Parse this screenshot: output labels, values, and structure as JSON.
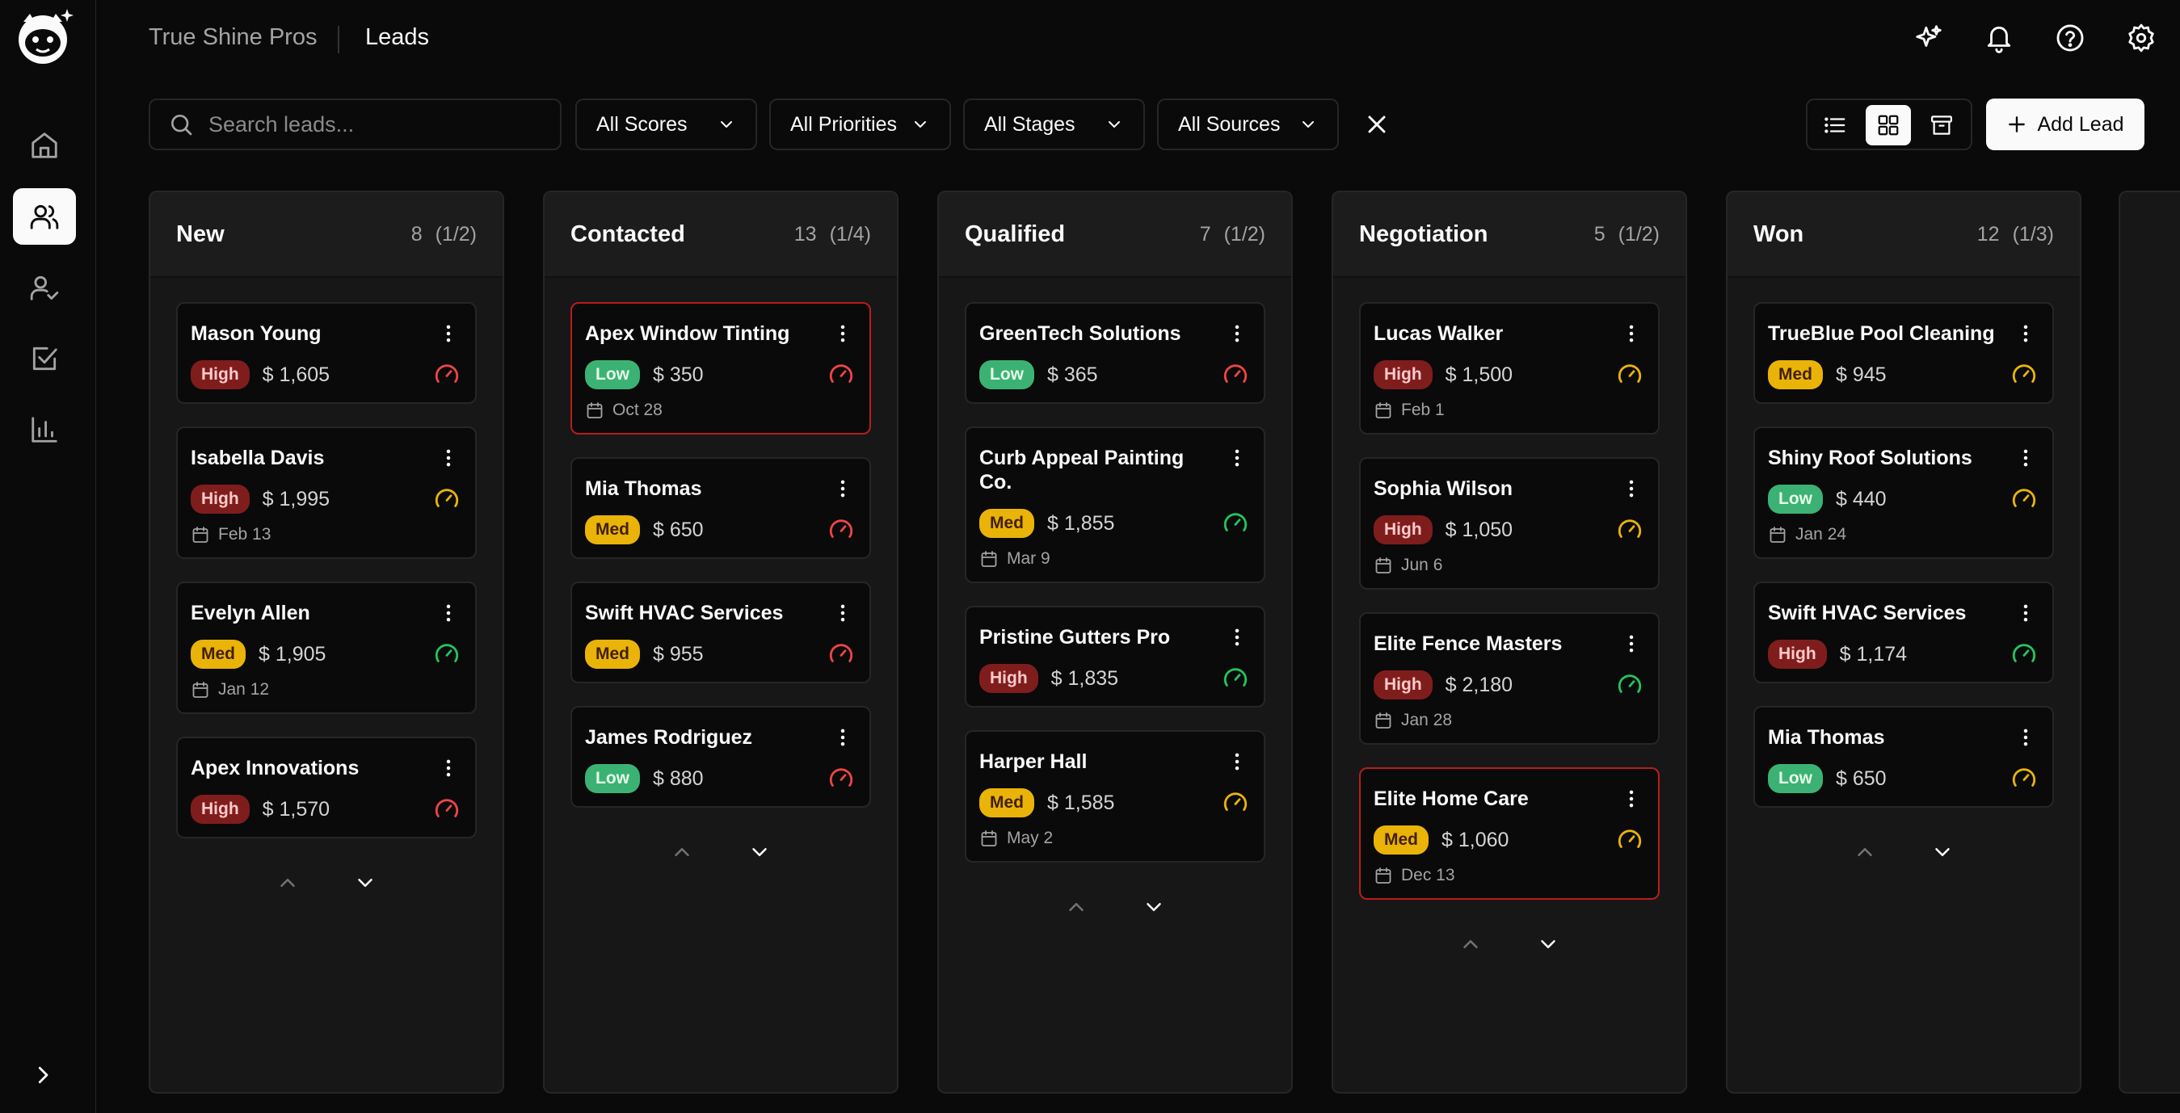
{
  "header": {
    "org": "True Shine Pros",
    "page": "Leads"
  },
  "toolbar": {
    "search_placeholder": "Search leads...",
    "filters": [
      "All Scores",
      "All Priorities",
      "All Stages",
      "All Sources"
    ],
    "add_lead_label": "Add Lead",
    "active_view": "board"
  },
  "sidebar": {
    "items": [
      "home-icon",
      "users-icon",
      "user-check-icon",
      "tasks-icon",
      "reports-icon"
    ],
    "active_index": 1
  },
  "colors": {
    "high": "#7f1d1d",
    "med": "#eab308",
    "low": "#3bb273",
    "alert_border": "#b91c1c",
    "gauge_red": "#ef4444",
    "gauge_yellow": "#eab308",
    "gauge_green": "#22c55e"
  },
  "columns": [
    {
      "title": "New",
      "count": "8",
      "page": "(1/2)",
      "cards": [
        {
          "name": "Mason Young",
          "priority": "High",
          "amount": "$ 1,605",
          "date": "",
          "gauge": "red",
          "alert": false
        },
        {
          "name": "Isabella Davis",
          "priority": "High",
          "amount": "$ 1,995",
          "date": "Feb 13",
          "gauge": "yellow",
          "alert": false
        },
        {
          "name": "Evelyn Allen",
          "priority": "Med",
          "amount": "$ 1,905",
          "date": "Jan 12",
          "gauge": "green",
          "alert": false
        },
        {
          "name": "Apex Innovations",
          "priority": "High",
          "amount": "$ 1,570",
          "date": "",
          "gauge": "red",
          "alert": false
        }
      ]
    },
    {
      "title": "Contacted",
      "count": "13",
      "page": "(1/4)",
      "cards": [
        {
          "name": "Apex Window Tinting",
          "priority": "Low",
          "amount": "$ 350",
          "date": "Oct 28",
          "gauge": "red",
          "alert": true
        },
        {
          "name": "Mia Thomas",
          "priority": "Med",
          "amount": "$ 650",
          "date": "",
          "gauge": "red",
          "alert": false
        },
        {
          "name": "Swift HVAC Services",
          "priority": "Med",
          "amount": "$ 955",
          "date": "",
          "gauge": "red",
          "alert": false
        },
        {
          "name": "James Rodriguez",
          "priority": "Low",
          "amount": "$ 880",
          "date": "",
          "gauge": "red",
          "alert": false
        }
      ]
    },
    {
      "title": "Qualified",
      "count": "7",
      "page": "(1/2)",
      "cards": [
        {
          "name": "GreenTech Solutions",
          "priority": "Low",
          "amount": "$ 365",
          "date": "",
          "gauge": "red",
          "alert": false
        },
        {
          "name": "Curb Appeal Painting Co.",
          "priority": "Med",
          "amount": "$ 1,855",
          "date": "Mar 9",
          "gauge": "green",
          "alert": false
        },
        {
          "name": "Pristine Gutters Pro",
          "priority": "High",
          "amount": "$ 1,835",
          "date": "",
          "gauge": "green",
          "alert": false
        },
        {
          "name": "Harper Hall",
          "priority": "Med",
          "amount": "$ 1,585",
          "date": "May 2",
          "gauge": "yellow",
          "alert": false
        }
      ]
    },
    {
      "title": "Negotiation",
      "count": "5",
      "page": "(1/2)",
      "cards": [
        {
          "name": "Lucas Walker",
          "priority": "High",
          "amount": "$ 1,500",
          "date": "Feb 1",
          "gauge": "yellow",
          "alert": false
        },
        {
          "name": "Sophia Wilson",
          "priority": "High",
          "amount": "$ 1,050",
          "date": "Jun 6",
          "gauge": "yellow",
          "alert": false
        },
        {
          "name": "Elite Fence Masters",
          "priority": "High",
          "amount": "$ 2,180",
          "date": "Jan 28",
          "gauge": "green",
          "alert": false
        },
        {
          "name": "Elite Home Care",
          "priority": "Med",
          "amount": "$ 1,060",
          "date": "Dec 13",
          "gauge": "yellow",
          "alert": true
        }
      ]
    },
    {
      "title": "Won",
      "count": "12",
      "page": "(1/3)",
      "cards": [
        {
          "name": "TrueBlue Pool Cleaning",
          "priority": "Med",
          "amount": "$ 945",
          "date": "",
          "gauge": "yellow",
          "alert": false
        },
        {
          "name": "Shiny Roof Solutions",
          "priority": "Low",
          "amount": "$ 440",
          "date": "Jan 24",
          "gauge": "yellow",
          "alert": false
        },
        {
          "name": "Swift HVAC Services",
          "priority": "High",
          "amount": "$ 1,174",
          "date": "",
          "gauge": "green",
          "alert": false
        },
        {
          "name": "Mia Thomas",
          "priority": "Low",
          "amount": "$ 650",
          "date": "",
          "gauge": "yellow",
          "alert": false
        }
      ]
    }
  ]
}
